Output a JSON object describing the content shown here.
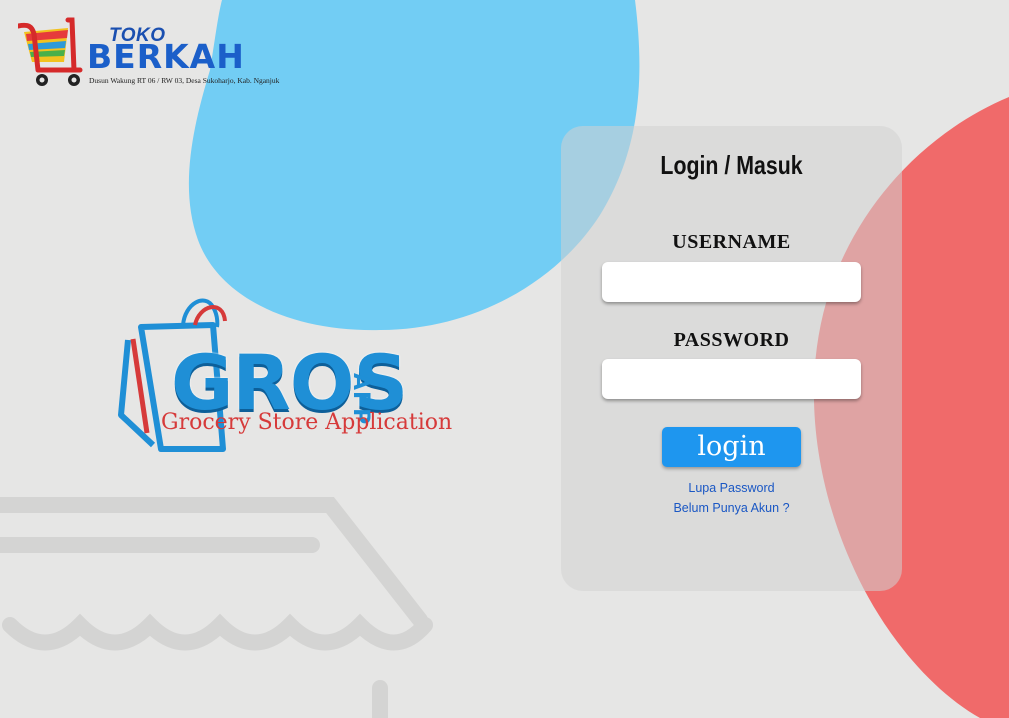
{
  "brand": {
    "prefix": "TOKO",
    "name": "BERKAH",
    "address": "Dusun Wakung RT 06 / RW 03, Desa Sukoharjo, Kab. Nganjuk"
  },
  "app_logo": {
    "word": "GROS",
    "suffix": "APP",
    "tagline": "Grocery Store Application"
  },
  "login": {
    "title": "Login / Masuk",
    "username_label": "USERNAME",
    "username_value": "",
    "password_label": "PASSWORD",
    "password_value": "",
    "button_label": "login",
    "forgot_link": "Lupa Password",
    "register_link": "Belum Punya Akun ?"
  },
  "colors": {
    "background": "#e6e6e5",
    "blue_blob": "#72cdf4",
    "red_blob": "#f06a6a",
    "button": "#1e96ef",
    "link": "#1a57c4"
  }
}
